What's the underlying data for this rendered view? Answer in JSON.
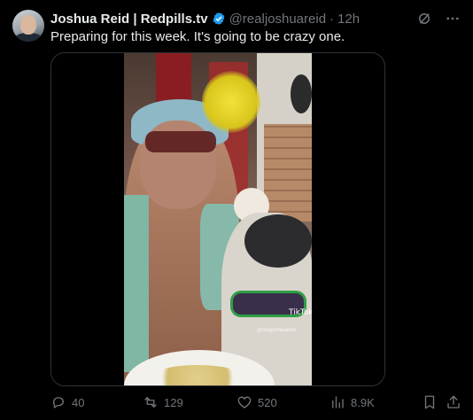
{
  "tweet": {
    "author_name": "Joshua Reid | Redpills.tv",
    "handle": "@realjoshuareid",
    "separator": "·",
    "time": "12h",
    "text": "Preparing for this week. It's going to be crazy one."
  },
  "media": {
    "watermark": "TikTok",
    "watermark_sub": "@realjoshuareid"
  },
  "actions": {
    "replies": "40",
    "reposts": "129",
    "likes": "520",
    "views": "8.9K"
  },
  "colors": {
    "background": "#000000",
    "text": "#e7e9ea",
    "muted": "#71767b",
    "verified": "#1d9bf0",
    "border": "#2f3336"
  },
  "icons": [
    "verified-badge-icon",
    "grok-icon",
    "more-icon",
    "reply-icon",
    "repost-icon",
    "like-icon",
    "views-icon",
    "bookmark-icon",
    "share-icon"
  ]
}
